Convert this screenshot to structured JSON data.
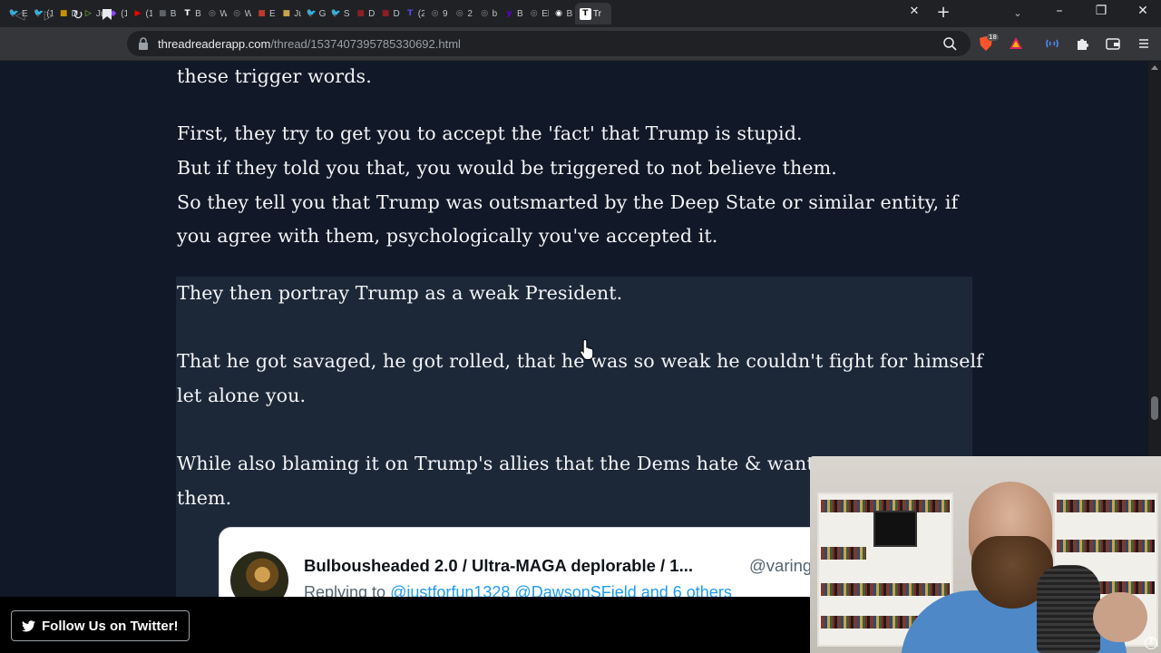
{
  "browser": {
    "tabs": [
      {
        "label": "Ec",
        "icon": "twitter-icon",
        "color": "#1d9bf0"
      },
      {
        "label": "(1",
        "icon": "twitter-icon",
        "color": "#1d9bf0"
      },
      {
        "label": "Di",
        "icon": "site-icon",
        "color": "#c79100"
      },
      {
        "label": "Ju",
        "icon": "rumble-icon",
        "color": "#85c742"
      },
      {
        "label": "(1",
        "icon": "twitch-icon",
        "color": "#9146ff"
      },
      {
        "label": "(1",
        "icon": "youtube-icon",
        "color": "#ff0000"
      },
      {
        "label": "Bi",
        "icon": "site-icon",
        "color": "#5f6368"
      },
      {
        "label": "Bi",
        "icon": "tumblr-icon",
        "color": "#ffffff"
      },
      {
        "label": "W",
        "icon": "globe-icon",
        "color": "#8a8d91"
      },
      {
        "label": "W",
        "icon": "globe-icon",
        "color": "#8a8d91"
      },
      {
        "label": "E",
        "icon": "site-icon",
        "color": "#c0392b"
      },
      {
        "label": "Ju",
        "icon": "site-icon",
        "color": "#c9a24d"
      },
      {
        "label": "G",
        "icon": "twitter-icon",
        "color": "#1d9bf0"
      },
      {
        "label": "Sc",
        "icon": "twitter-icon",
        "color": "#1d9bf0"
      },
      {
        "label": "D",
        "icon": "site-icon",
        "color": "#8c1f24"
      },
      {
        "label": "D",
        "icon": "site-icon",
        "color": "#8c1f24"
      },
      {
        "label": "(2",
        "icon": "truth-icon",
        "color": "#5448ee"
      },
      {
        "label": "9",
        "icon": "globe-icon",
        "color": "#8a8d91"
      },
      {
        "label": "2",
        "icon": "globe-icon",
        "color": "#8a8d91"
      },
      {
        "label": "b",
        "icon": "globe-icon",
        "color": "#8a8d91"
      },
      {
        "label": "Bi",
        "icon": "yahoo-icon",
        "color": "#6001d2"
      },
      {
        "label": "El",
        "icon": "globe-icon",
        "color": "#8a8d91"
      },
      {
        "label": "Bi",
        "icon": "cbs-icon",
        "color": "#ffffff"
      }
    ],
    "active_tab": {
      "label": "Tr",
      "icon": "threadreader-icon"
    },
    "url_host": "threadreaderapp.com",
    "url_path": "/thread/1537407395785330692.html",
    "brave_badge": "18"
  },
  "article": {
    "line_0": "these trigger words.",
    "line_1": "First, they try to get you to accept the 'fact' that Trump is stupid.",
    "line_2": "But if they told you that, you would be triggered to not believe them.",
    "line_3": "So they tell you that Trump was outsmarted by the Deep State or similar entity, if",
    "line_4": "you agree with them, psychologically you've accepted it.",
    "line_5": "They then portray Trump as a weak President.",
    "line_6": "That he got savaged, he got rolled, that he was so weak he couldn't fight for himself",
    "line_7": "let alone you.",
    "line_8": "While also blaming it on Trump's allies that the Dems hate & want y",
    "line_9": "them."
  },
  "embedded_tweet": {
    "name": "Bulbousheaded 2.0 / Ultra-MAGA deplorable / 1...",
    "handle": "@varing",
    "reply_prefix": "Replying to ",
    "reply_mentions": "@justforfun1328 @DawsonSField and 6 others"
  },
  "footer": {
    "follow_label": "Follow Us on Twitter!"
  },
  "colors": {
    "page_bg": "#111827",
    "highlight_bg": "#1c2838",
    "text": "#f3f4f6",
    "twitter_blue": "#1d9bf0"
  }
}
